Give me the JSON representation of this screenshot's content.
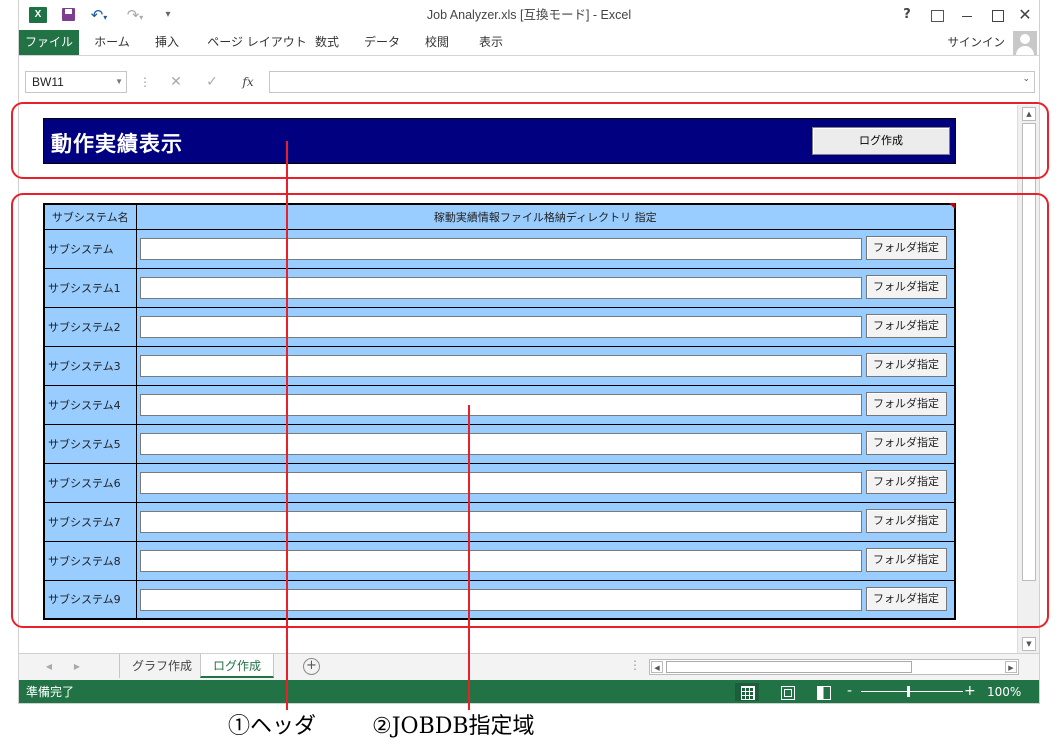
{
  "window": {
    "app_icon": "excel-icon",
    "title": "Job Analyzer.xls  [互換モード] - Excel",
    "controls": {
      "help": "?",
      "close": "✕"
    }
  },
  "quick_access": {
    "undo": "↶",
    "undo_dd": "▾",
    "redo": "↷",
    "redo_dd": "▾",
    "customize": "▾"
  },
  "ribbon": {
    "tabs": [
      "ファイル",
      "ホーム",
      "挿入",
      "ページ レイアウト",
      "数式",
      "データ",
      "校閲",
      "表示"
    ],
    "signin": "サインイン"
  },
  "formula_bar": {
    "name_box": "BW11",
    "dots": "⋮",
    "cancel": "✕",
    "enter": "✓",
    "fx": "fx",
    "value": ""
  },
  "sheet": {
    "header": {
      "title": "動作実績表示",
      "log_button": "ログ作成"
    },
    "table": {
      "col_name": "サブシステム名",
      "col_dir": "稼動実績情報ファイル格納ディレクトリ 指定",
      "button_label": "フォルダ指定",
      "rows": [
        {
          "name": "サブシステム",
          "path": ""
        },
        {
          "name": "サブシステム1",
          "path": ""
        },
        {
          "name": "サブシステム2",
          "path": ""
        },
        {
          "name": "サブシステム3",
          "path": ""
        },
        {
          "name": "サブシステム4",
          "path": ""
        },
        {
          "name": "サブシステム5",
          "path": ""
        },
        {
          "name": "サブシステム6",
          "path": ""
        },
        {
          "name": "サブシステム7",
          "path": ""
        },
        {
          "name": "サブシステム8",
          "path": ""
        },
        {
          "name": "サブシステム9",
          "path": ""
        }
      ]
    }
  },
  "sheet_tabs": {
    "tabs": [
      "グラフ作成",
      "ログ作成"
    ],
    "active": "ログ作成",
    "add": "+"
  },
  "status_bar": {
    "status": "準備完了",
    "zoom": "100%",
    "zoom_minus": "-",
    "zoom_plus": "+"
  },
  "annotations": {
    "header_label": "①ヘッダ",
    "jobdb_label": "②JOBDB指定域",
    "outline_color": "#e8202a"
  },
  "colors": {
    "excel_green": "#217346",
    "header_bg": "#000080",
    "table_bg": "#99ccff"
  }
}
